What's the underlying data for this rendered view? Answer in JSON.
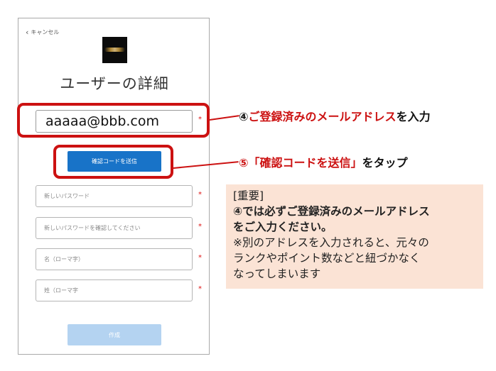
{
  "form": {
    "cancel_label": "キャンセル",
    "title": "ユーザーの詳細",
    "email_value": "aaaaa@bbb.com",
    "required_mark": "*",
    "send_code_label": "確認コードを送信",
    "new_password_placeholder": "新しいパスワード",
    "confirm_password_placeholder": "新しいパスワードを確認してください",
    "first_name_placeholder": "名（ローマ字）",
    "last_name_placeholder": "姓（ローマ字",
    "create_label": "作成"
  },
  "annotations": {
    "step4_marker": "④",
    "step4_red": "ご登録済みのメールアドレス",
    "step4_tail": "を入力",
    "step5_red": "⑤「確認コードを送信」",
    "step5_tail": "をタップ"
  },
  "notice": {
    "heading": "[重要]",
    "bold_line1": "④では必ずご登録済みのメールアドレス",
    "bold_line2": "をご入力ください。",
    "line3": "※別のアドレスを入力されると、元々の",
    "line4": "ランクやポイント数などと紐づかなく",
    "line5": "なってしまいます"
  },
  "colors": {
    "highlight": "#cc1111",
    "primary_button": "#1873c8",
    "disabled_button": "#b4d3f1",
    "notice_background": "#fbe3d5"
  }
}
